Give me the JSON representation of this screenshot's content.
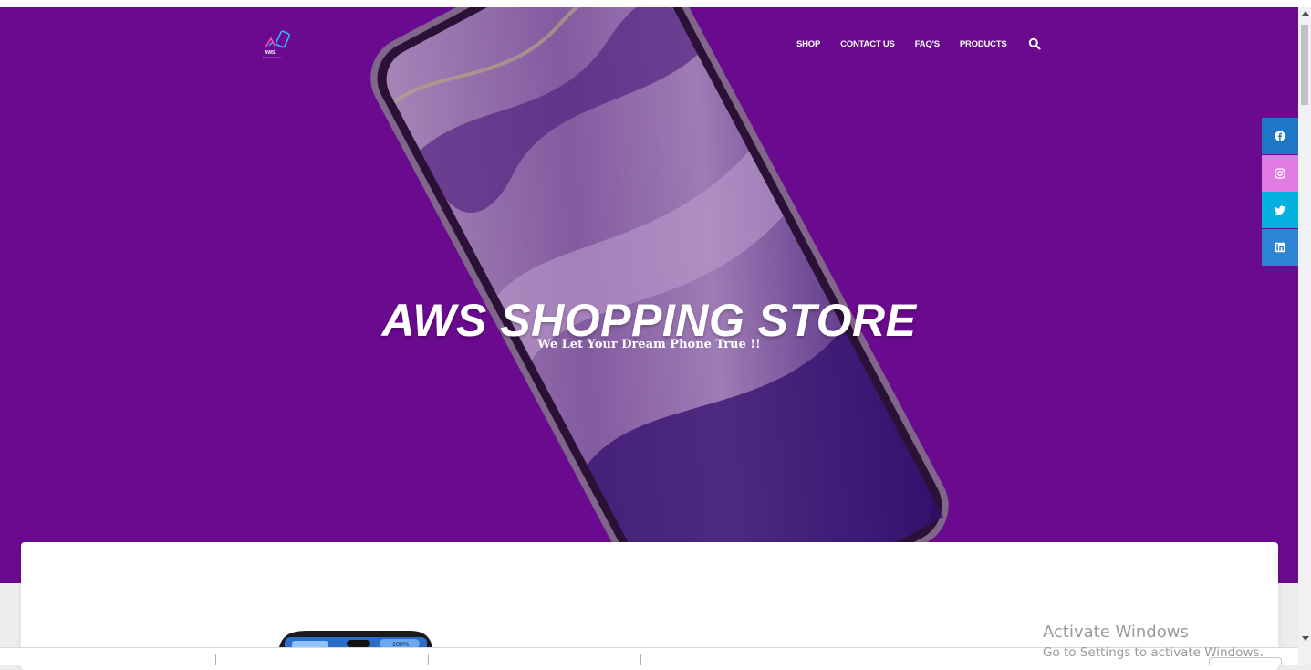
{
  "brand": {
    "logo_text_line1": "AWS",
    "logo_text_line2": "Shopping Store"
  },
  "nav": {
    "shop": "SHOP",
    "contact": "CONTACT US",
    "faqs": "FAQ'S",
    "products": "PRODUCTS",
    "search_icon": "search-icon"
  },
  "hero": {
    "title": "AWS SHOPPING STORE",
    "subtitle": "We Let Your Dream Phone True !!"
  },
  "social": [
    {
      "name": "facebook",
      "icon": "facebook-icon",
      "color": "#1e77c6"
    },
    {
      "name": "instagram",
      "icon": "instagram-icon",
      "color": "#e27ae3"
    },
    {
      "name": "twitter",
      "icon": "twitter-icon",
      "color": "#03b1de"
    },
    {
      "name": "linkedin",
      "icon": "linkedin-icon",
      "color": "#2c84d4"
    }
  ],
  "product_preview": {
    "battery": "100%"
  },
  "watermark": {
    "line1": "Activate Windows",
    "line2": "Go to Settings to activate Windows."
  },
  "colors": {
    "hero_bg": "#6a0a8e",
    "accent": "#ffffff"
  }
}
